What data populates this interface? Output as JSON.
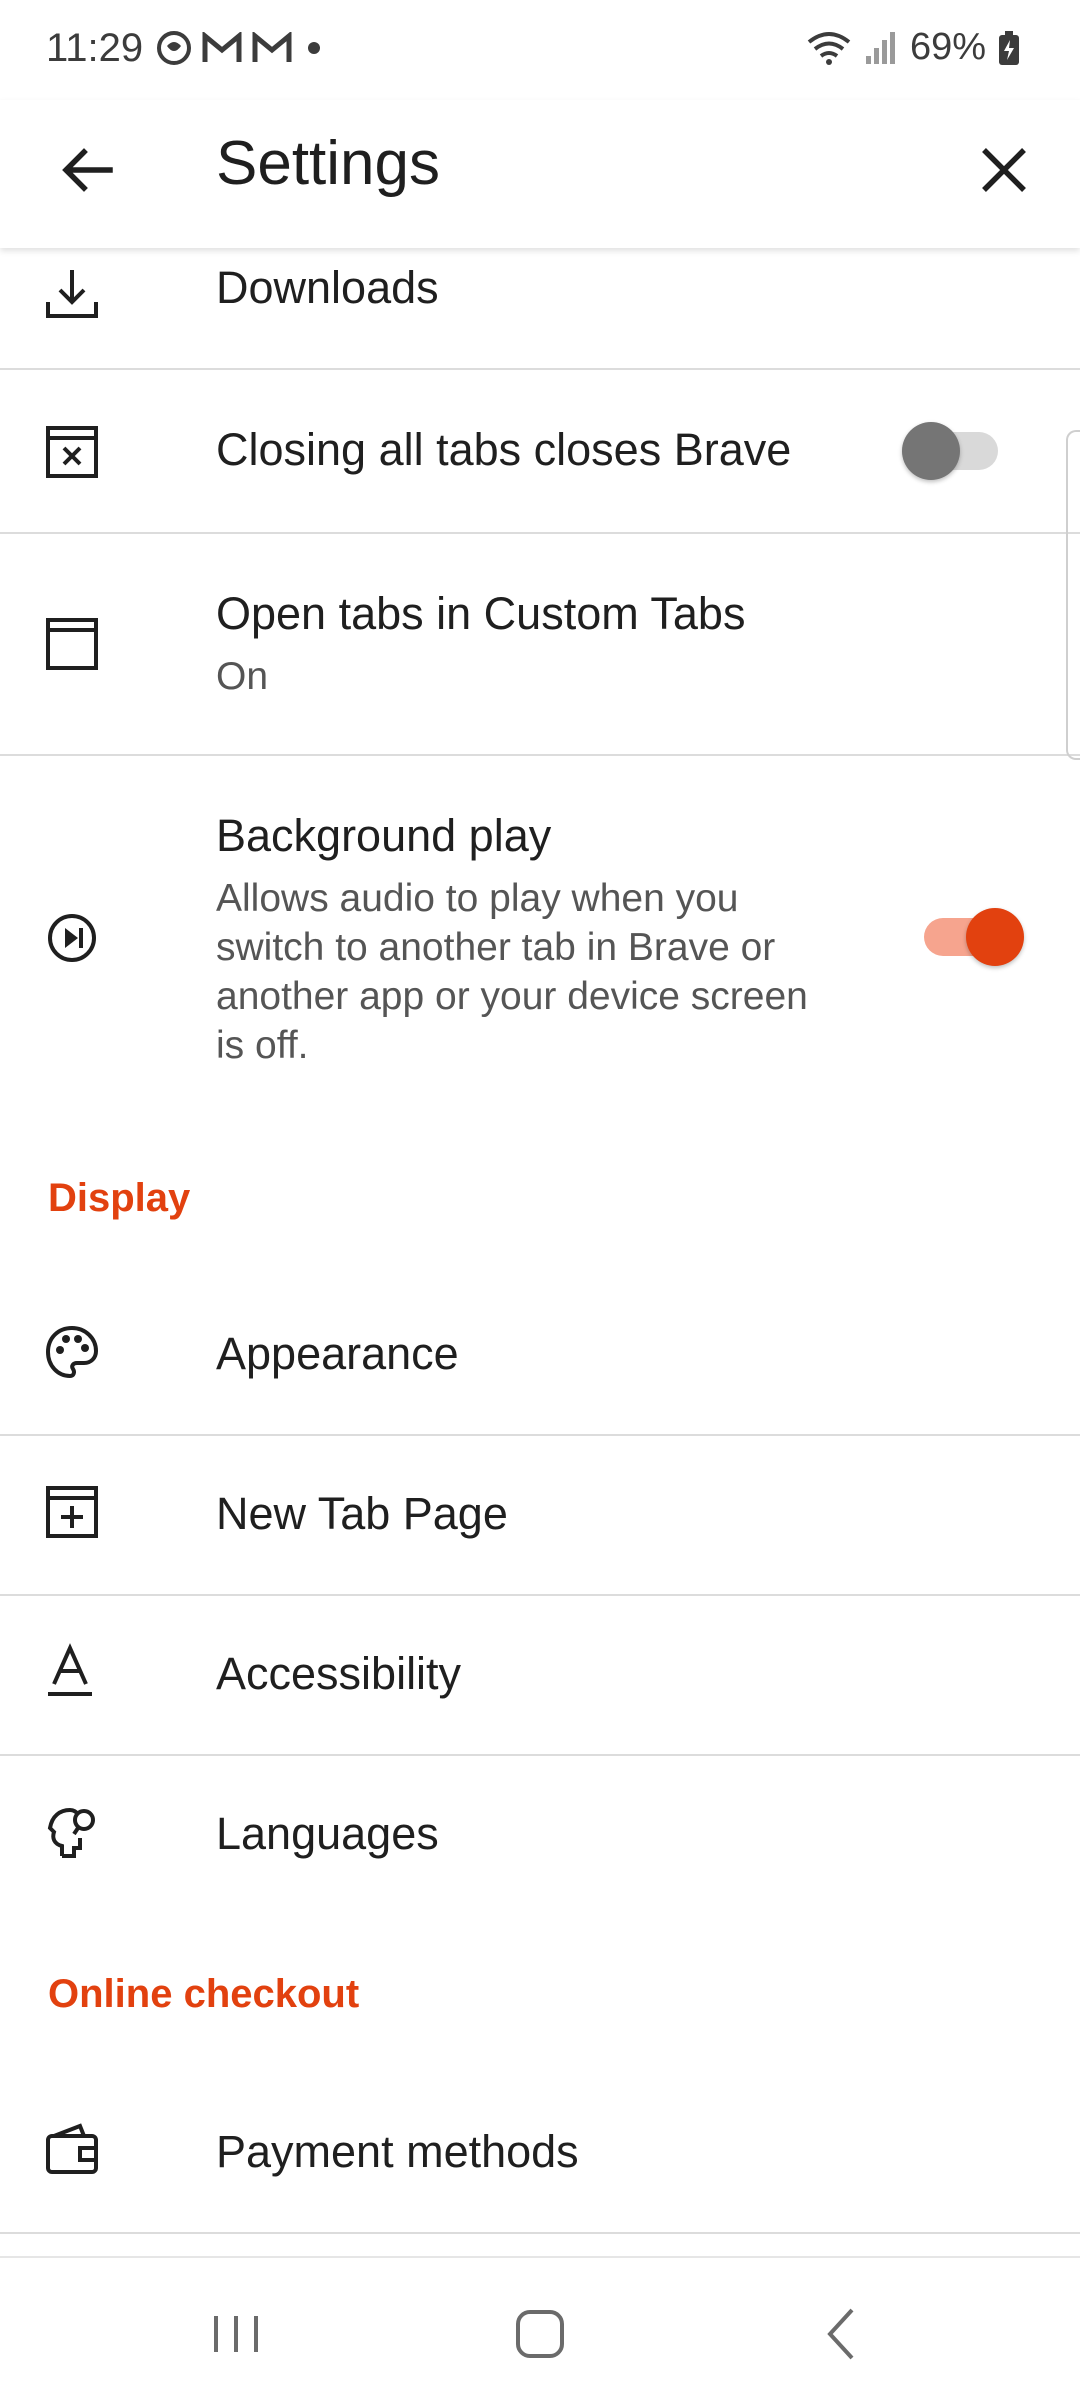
{
  "status_bar": {
    "time": "11:29",
    "battery": "69%"
  },
  "appbar": {
    "title": "Settings"
  },
  "items": {
    "downloads": {
      "title": "Downloads"
    },
    "closing_tabs": {
      "title": "Closing all tabs closes Brave",
      "enabled": false
    },
    "custom_tabs": {
      "title": "Open tabs in Custom Tabs",
      "subtitle": "On"
    },
    "background_play": {
      "title": "Background play",
      "subtitle": "Allows audio to play when you switch to another tab in Brave or another app or your device screen is off.",
      "enabled": true
    },
    "appearance": {
      "title": "Appearance"
    },
    "new_tab_page": {
      "title": "New Tab Page"
    },
    "accessibility": {
      "title": "Accessibility"
    },
    "languages": {
      "title": "Languages"
    },
    "payment_methods": {
      "title": "Payment methods"
    }
  },
  "sections": {
    "display": "Display",
    "online_checkout": "Online checkout"
  },
  "colors": {
    "accent": "#e2410f",
    "divider": "#dcdcdc"
  }
}
